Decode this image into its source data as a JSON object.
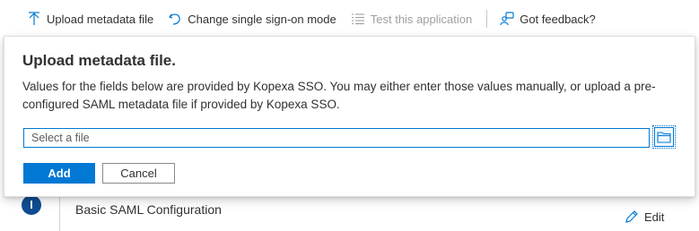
{
  "toolbar": {
    "upload_label": "Upload metadata file",
    "change_sso_label": "Change single sign-on mode",
    "test_app_label": "Test this application",
    "feedback_label": "Got feedback?"
  },
  "dialog": {
    "title": "Upload metadata file.",
    "description": "Values for the fields below are provided by Kopexa SSO. You may either enter those values manually, or upload a pre-configured SAML metadata file if provided by Kopexa SSO.",
    "file_placeholder": "Select a file",
    "add_label": "Add",
    "cancel_label": "Cancel"
  },
  "background": {
    "step_title": "Basic SAML Configuration",
    "edit_label": "Edit"
  },
  "colors": {
    "accent": "#0078d4",
    "text": "#323130",
    "disabled": "#a19f9d",
    "step_circle": "#0f4d91"
  },
  "icons": {
    "upload": "upload-arrow-icon",
    "change_sso": "undo-arrow-icon",
    "test_app": "list-icon",
    "feedback": "feedback-person-icon",
    "folder": "folder-icon",
    "edit": "pencil-icon"
  }
}
